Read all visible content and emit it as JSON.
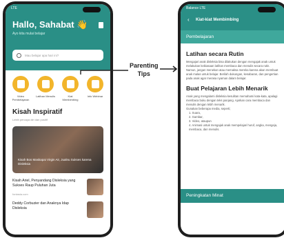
{
  "annotation": {
    "line1": "Parenting",
    "line2": "Tips"
  },
  "left_screen": {
    "status_carrier": "LTE",
    "greeting": "Hallo, Sahabat 👋",
    "subtitle": "Ayo kita mulai belajar",
    "search_placeholder": "Mau belajar apa hari ini?",
    "categories": [
      {
        "label": "Video Pembelajaran"
      },
      {
        "label": "Latihan Menulis"
      },
      {
        "label": "Kiat Membimbing"
      },
      {
        "label": "Info Webinar"
      }
    ],
    "section_title": "Kisah Inspiratif",
    "section_subtitle": "Lebih percaya diri dan positif",
    "feature_caption": "Kisah Bos Maskapai Virgin Air, Jualnu Sukses karena Disleksia",
    "articles": [
      {
        "title": "Kisah Ariel, Penyandang Disleksia yang Sukses Raup Puluhan Juta",
        "source": "fontasia.com"
      },
      {
        "title": "Deddy Corbuzier dan Anaknya Idap Disleksia",
        "source": ""
      }
    ]
  },
  "right_screen": {
    "status_carrier": "Balance LTE",
    "header_title": "Kiat-kiat Membimbing",
    "top_band": "Pembelajaran",
    "h1": "Latihan secara Rutin",
    "p1": "Mengajari anak disleksia bisa dilakukan dengan mengajak anak untuk melakukan kebiasaan latihan membaca dan menulis secara rutin. Namun, jangan menekan atau memaksa mereka karena akan membuat anak malas untuk belajar. Berilah dukungan, kesabaran, dan pengertian pada anak agar merasa nyaman dalam belajar.",
    "h2": "Buat Pelajaran Lebih Menarik",
    "p2": "Anak yang mengalami disleksia kesulitan memahami kata-kata, apalagi membaca buku dengan teks panjang. Ajarkan cara membaca dan menulis dengan lebih menarik.",
    "p3": "Gunakan beberapa media, seperti;",
    "list": [
      "1. Suara,",
      "2. Gambar,",
      "3. Video, ataupun",
      "4. Animasi untuk mengajak anak mempelajari huruf, angka, mengeja, membaca, dan menulis."
    ],
    "bottom_band": "Peningkatan Minat"
  }
}
